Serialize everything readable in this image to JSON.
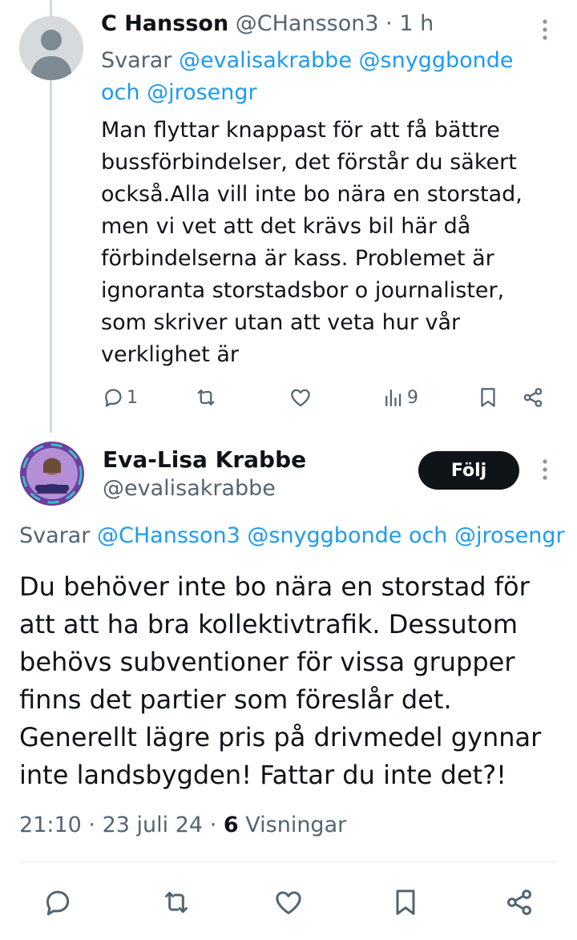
{
  "reply": {
    "name": "C Hansson",
    "handle": "@CHansson3",
    "sep": "·",
    "time": "1 h",
    "svarar_prefix": "Svarar",
    "mentions": [
      "@evalisakrabbe",
      "@snyggbonde"
    ],
    "and_word": "och",
    "mention_last": "@jrosengr",
    "body": "Man flyttar knappast för att få bättre bussförbindelser, det förstår du säkert också.Alla vill inte bo nära en storstad, men vi vet att det krävs bil här då förbindelserna är kass. Problemet är ignoranta storstadsbor o journalister, som skriver utan att veta hur vår verklighet är",
    "reply_count": "1",
    "views_count": "9"
  },
  "main": {
    "name": "Eva-Lisa Krabbe",
    "handle": "@evalisakrabbe",
    "follow_label": "Följ",
    "svarar_prefix": "Svarar",
    "mention_1": "@CHansson3",
    "mention_2": "@snyggbonde",
    "and_word": "och",
    "mention_3": "@jrosengr",
    "body": "Du behöver inte bo nära en storstad för att att ha bra kollektivtrafik. Dessutom behövs subventioner för vissa grupper finns det partier som föreslår det. Generellt lägre pris på drivmedel gynnar inte landsbygden! Fattar du inte det?!",
    "time": "21:10",
    "sep": "·",
    "date": "23 juli 24",
    "views_number": "6",
    "views_label": "Visningar"
  },
  "colors": {
    "link": "#1d9bf0",
    "muted": "#536471",
    "text": "#0f1419",
    "follow_bg": "#0f1419"
  },
  "icons": [
    "more-icon",
    "reply-icon",
    "retweet-icon",
    "like-icon",
    "views-icon",
    "bookmark-icon",
    "share-icon"
  ]
}
